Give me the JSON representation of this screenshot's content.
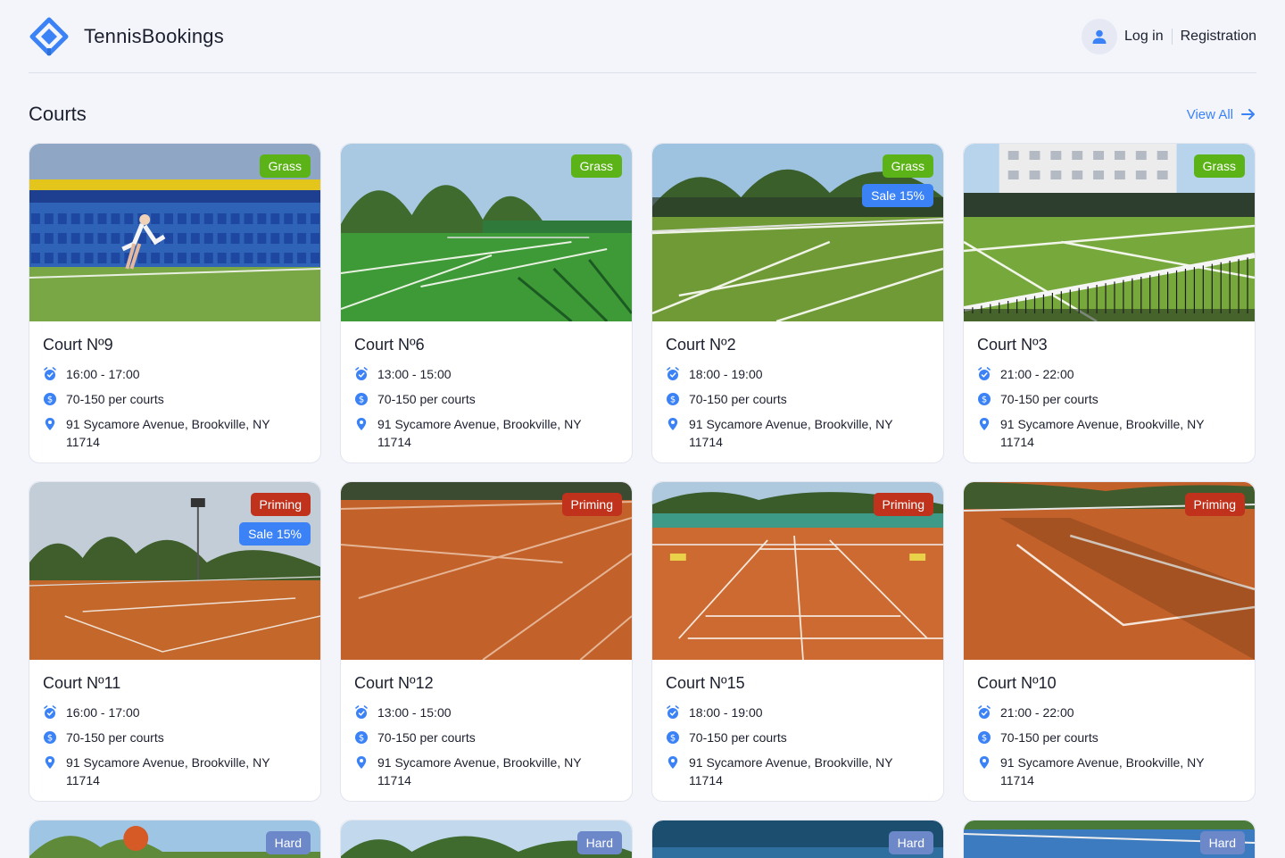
{
  "header": {
    "brand": "TennisBookings",
    "login": "Log in",
    "registration": "Registration"
  },
  "section": {
    "title": "Courts",
    "view_all": "View All"
  },
  "colors": {
    "accent": "#3b82f6",
    "grass_badge": "#5bb318",
    "priming_badge": "#c0321c",
    "hard_badge": "#6c88c9"
  },
  "courts": [
    {
      "name": "Court Nº9",
      "time": "16:00 - 17:00",
      "price": "70-150 per courts",
      "address": "91 Sycamore Avenue, Brookville, NY 11714",
      "surface": "Grass",
      "sale": ""
    },
    {
      "name": "Court Nº6",
      "time": "13:00 - 15:00",
      "price": "70-150 per courts",
      "address": "91 Sycamore Avenue, Brookville, NY 11714",
      "surface": "Grass",
      "sale": ""
    },
    {
      "name": "Court Nº2",
      "time": "18:00 - 19:00",
      "price": "70-150 per courts",
      "address": "91 Sycamore Avenue, Brookville, NY 11714",
      "surface": "Grass",
      "sale": "Sale 15%"
    },
    {
      "name": "Court Nº3",
      "time": "21:00 - 22:00",
      "price": "70-150 per courts",
      "address": "91 Sycamore Avenue, Brookville, NY 11714",
      "surface": "Grass",
      "sale": ""
    },
    {
      "name": "Court Nº11",
      "time": "16:00 - 17:00",
      "price": "70-150 per courts",
      "address": "91 Sycamore Avenue, Brookville, NY 11714",
      "surface": "Priming",
      "sale": "Sale 15%"
    },
    {
      "name": "Court Nº12",
      "time": "13:00 - 15:00",
      "price": "70-150 per courts",
      "address": "91 Sycamore Avenue, Brookville, NY 11714",
      "surface": "Priming",
      "sale": ""
    },
    {
      "name": "Court Nº15",
      "time": "18:00 - 19:00",
      "price": "70-150 per courts",
      "address": "91 Sycamore Avenue, Brookville, NY 11714",
      "surface": "Priming",
      "sale": ""
    },
    {
      "name": "Court Nº10",
      "time": "21:00 - 22:00",
      "price": "70-150 per courts",
      "address": "91 Sycamore Avenue, Brookville, NY 11714",
      "surface": "Priming",
      "sale": ""
    },
    {
      "surface": "Hard"
    },
    {
      "surface": "Hard"
    },
    {
      "surface": "Hard"
    },
    {
      "surface": "Hard"
    }
  ]
}
